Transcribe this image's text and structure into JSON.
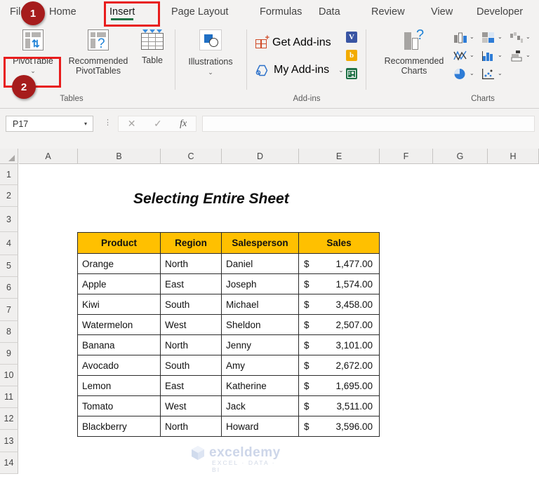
{
  "app": {
    "name": "Microsoft Excel"
  },
  "ribbon": {
    "tabs": [
      {
        "label": "File",
        "active": false
      },
      {
        "label": "Home",
        "active": false
      },
      {
        "label": "Insert",
        "active": true
      },
      {
        "label": "Page Layout",
        "active": false
      },
      {
        "label": "Formulas",
        "active": false
      },
      {
        "label": "Data",
        "active": false
      },
      {
        "label": "Review",
        "active": false
      },
      {
        "label": "View",
        "active": false
      },
      {
        "label": "Developer",
        "active": false
      }
    ],
    "active_tab_accent": "#217346",
    "groups": [
      {
        "name": "Tables"
      },
      {
        "name": "Illustrations_unlabeled"
      },
      {
        "name": "Add-ins"
      },
      {
        "name": "Charts"
      }
    ],
    "group_labels": {
      "tables": "Tables",
      "addins": "Add-ins",
      "charts": "Charts"
    },
    "buttons": {
      "pivot_table": "PivotTable",
      "recommended_pivot_tables_line1": "Recommended",
      "recommended_pivot_tables_line2": "PivotTables",
      "table": "Table",
      "illustrations": "Illustrations",
      "get_addins": "Get Add-ins",
      "my_addins": "My Add-ins",
      "recommended_charts_line1": "Recommended",
      "recommended_charts_line2": "Charts"
    },
    "store_icons": [
      {
        "name": "visio-icon",
        "glyph": "V",
        "color": "#3955a3"
      },
      {
        "name": "bing-icon",
        "glyph": "b",
        "color": "#f2ab00"
      },
      {
        "name": "people-graph-icon",
        "glyph": "",
        "color": "#1e7145"
      }
    ],
    "chart_icons": [
      "column-chart-icon",
      "bar-chart-icon",
      "waterfall-chart-icon",
      "line-chart-icon",
      "histogram-chart-icon",
      "funnel-chart-icon",
      "pie-chart-icon",
      "scatter-chart-icon"
    ]
  },
  "formula_bar": {
    "name_box_value": "P17",
    "name_box_chevron": "⌄",
    "cancel_icon": "✕",
    "enter_icon": "✓",
    "function_icon": "fx",
    "formula_value": "",
    "more_icon": "⋮"
  },
  "grid": {
    "columns": [
      "A",
      "B",
      "C",
      "D",
      "E",
      "F",
      "G",
      "H"
    ],
    "rows": [
      "1",
      "2",
      "3",
      "4",
      "5",
      "6",
      "7",
      "8",
      "9",
      "10",
      "11",
      "12",
      "13",
      "14"
    ],
    "sheet_title": "Selecting Entire Sheet"
  },
  "table": {
    "headers": [
      "Product",
      "Region",
      "Salesperson",
      "Sales"
    ],
    "header_fill": "#ffc000",
    "currency_symbol": "$",
    "rows": [
      {
        "product": "Orange",
        "region": "North",
        "salesperson": "Daniel",
        "sales": "1,477.00"
      },
      {
        "product": "Apple",
        "region": "East",
        "salesperson": "Joseph",
        "sales": "1,574.00"
      },
      {
        "product": "Kiwi",
        "region": "South",
        "salesperson": "Michael",
        "sales": "3,458.00"
      },
      {
        "product": "Watermelon",
        "region": "West",
        "salesperson": "Sheldon",
        "sales": "2,507.00"
      },
      {
        "product": "Banana",
        "region": "North",
        "salesperson": "Jenny",
        "sales": "3,101.00"
      },
      {
        "product": "Avocado",
        "region": "South",
        "salesperson": "Amy",
        "sales": "2,672.00"
      },
      {
        "product": "Lemon",
        "region": "East",
        "salesperson": "Katherine",
        "sales": "1,695.00"
      },
      {
        "product": "Tomato",
        "region": "West",
        "salesperson": "Jack",
        "sales": "3,511.00"
      },
      {
        "product": "Blackberry",
        "region": "North",
        "salesperson": "Howard",
        "sales": "3,596.00"
      }
    ]
  },
  "annotations": {
    "highlight_color": "#e81c1c",
    "badge_color": "#a61c1c",
    "steps": [
      {
        "number": "1",
        "target": "Insert"
      },
      {
        "number": "2",
        "target": "PivotTable"
      }
    ]
  },
  "watermark": {
    "name": "exceldemy",
    "tagline": "EXCEL · DATA · BI"
  }
}
